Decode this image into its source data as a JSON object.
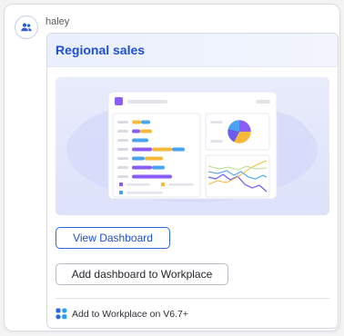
{
  "message": {
    "sender": "haley",
    "sender_icon": "users-icon"
  },
  "card": {
    "title": "Regional sales",
    "primary_button": "View Dashboard",
    "secondary_button": "Add dashboard to Workplace",
    "footer_text": "Add to Workplace on V6.7+",
    "footer_icon": "workplace-app-icon",
    "colors": {
      "accent": "#1d4fd8",
      "header_bg": "#eaf0fd",
      "preview_bg": "#e2e6fb"
    }
  }
}
